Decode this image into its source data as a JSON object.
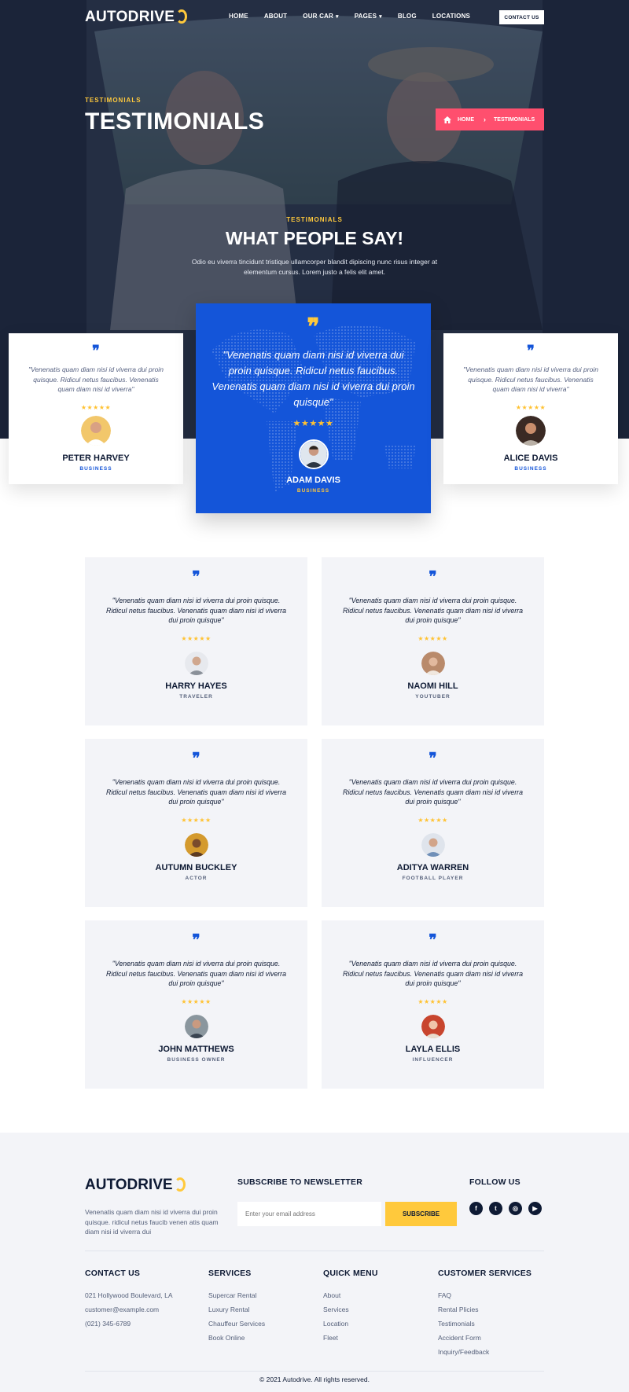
{
  "header": {
    "logo": "AUTODRIVE",
    "nav": [
      {
        "label": "HOME",
        "dropdown": false
      },
      {
        "label": "ABOUT",
        "dropdown": false
      },
      {
        "label": "OUR CAR",
        "dropdown": true
      },
      {
        "label": "PAGES",
        "dropdown": true
      },
      {
        "label": "BLOG",
        "dropdown": false
      },
      {
        "label": "LOCATIONS",
        "dropdown": false
      }
    ],
    "contact_button": "CONTACT US"
  },
  "page_banner": {
    "eyebrow": "TESTIMONIALS",
    "title": "TESTIMONIALS",
    "breadcrumb": {
      "home": "HOME",
      "current": "TESTIMONIALS"
    }
  },
  "section": {
    "eyebrow": "TESTIMONIALS",
    "title": "WHAT PEOPLE SAY!",
    "subtitle": "Odio eu viverra tincidunt tristique ullamcorper blandit dipiscing nunc risus integer at elementum cursus. Lorem justo a felis elit amet."
  },
  "featured": {
    "left": {
      "quote": "\"Venenatis quam diam nisi id viverra dui proin quisque. Ridicul netus faucibus. Venenatis quam diam nisi id viverra\"",
      "stars": "★★★★★",
      "name": "PETER HARVEY",
      "role": "BUSINESS"
    },
    "center": {
      "quote": "\"Venenatis quam diam nisi id viverra dui proin quisque. Ridicul netus faucibus. Venenatis quam diam nisi id viverra dui proin quisque\"",
      "stars": "★★★★★",
      "name": "ADAM DAVIS",
      "role": "BUSINESS"
    },
    "right": {
      "quote": "\"Venenatis quam diam nisi id viverra dui proin quisque. Ridicul netus faucibus. Venenatis quam diam nisi id viverra\"",
      "stars": "★★★★★",
      "name": "ALICE DAVIS",
      "role": "BUSINESS"
    }
  },
  "testimonials": [
    {
      "quote": "\"Venenatis quam diam nisi id viverra dui proin quisque. Ridicul netus faucibus. Venenatis quam diam nisi id viverra dui proin quisque\"",
      "stars": "★★★★★",
      "name": "HARRY HAYES",
      "role": "TRAVELER"
    },
    {
      "quote": "\"Venenatis quam diam nisi id viverra dui proin quisque. Ridicul netus faucibus. Venenatis quam diam nisi id viverra dui proin quisque\"",
      "stars": "★★★★★",
      "name": "NAOMI HILL",
      "role": "YOUTUBER"
    },
    {
      "quote": "\"Venenatis quam diam nisi id viverra dui proin quisque. Ridicul netus faucibus. Venenatis quam diam nisi id viverra dui proin quisque\"",
      "stars": "★★★★★",
      "name": "AUTUMN BUCKLEY",
      "role": "ACTOR"
    },
    {
      "quote": "\"Venenatis quam diam nisi id viverra dui proin quisque. Ridicul netus faucibus. Venenatis quam diam nisi id viverra dui proin quisque\"",
      "stars": "★★★★★",
      "name": "ADITYA WARREN",
      "role": "FOOTBALL PLAYER"
    },
    {
      "quote": "\"Venenatis quam diam nisi id viverra dui proin quisque. Ridicul netus faucibus. Venenatis quam diam nisi id viverra dui proin quisque\"",
      "stars": "★★★★★",
      "name": "JOHN MATTHEWS",
      "role": "BUSINESS OWNER"
    },
    {
      "quote": "\"Venenatis quam diam nisi id viverra dui proin quisque. Ridicul netus faucibus. Venenatis quam diam nisi id viverra dui proin quisque\"",
      "stars": "★★★★★",
      "name": "LAYLA ELLIS",
      "role": "INFLUENCER"
    }
  ],
  "footer": {
    "logo": "AUTODRIVE",
    "about": "Venenatis quam diam nisi id viverra dui proin quisque. ridicul netus faucib venen atis quam diam nisi id viverra dui",
    "newsletter": {
      "heading": "SUBSCRIBE TO NEWSLETTER",
      "placeholder": "Enter your email address",
      "button": "SUBSCRIBE"
    },
    "follow": {
      "heading": "FOLLOW US",
      "icons": [
        "facebook-icon",
        "twitter-icon",
        "instagram-icon",
        "youtube-icon"
      ],
      "glyphs": [
        "f",
        "t",
        "◎",
        "▶"
      ]
    },
    "contact": {
      "heading": "CONTACT US",
      "lines": [
        "021 Hollywood Boulevard, LA",
        "customer@example.com",
        "(021) 345-6789"
      ]
    },
    "services": {
      "heading": "SERVICES",
      "links": [
        "Supercar Rental",
        "Luxury Rental",
        "Chauffeur Services",
        "Book Online"
      ]
    },
    "quick_menu": {
      "heading": "QUICK MENU",
      "links": [
        "About",
        "Services",
        "Location",
        "Fleet"
      ]
    },
    "customer_services": {
      "heading": "CUSTOMER SERVICES",
      "links": [
        "FAQ",
        "Rental Plicies",
        "Testimonials",
        "Accident Form",
        "Inquiry/Feedback"
      ]
    },
    "copyright": "© 2021 Autodrive. All rights reserved."
  },
  "colors": {
    "primary": "#1455d9",
    "accent": "#ffc93c",
    "breadcrumb": "#ff4f6e",
    "dark": "#0e1a34"
  }
}
